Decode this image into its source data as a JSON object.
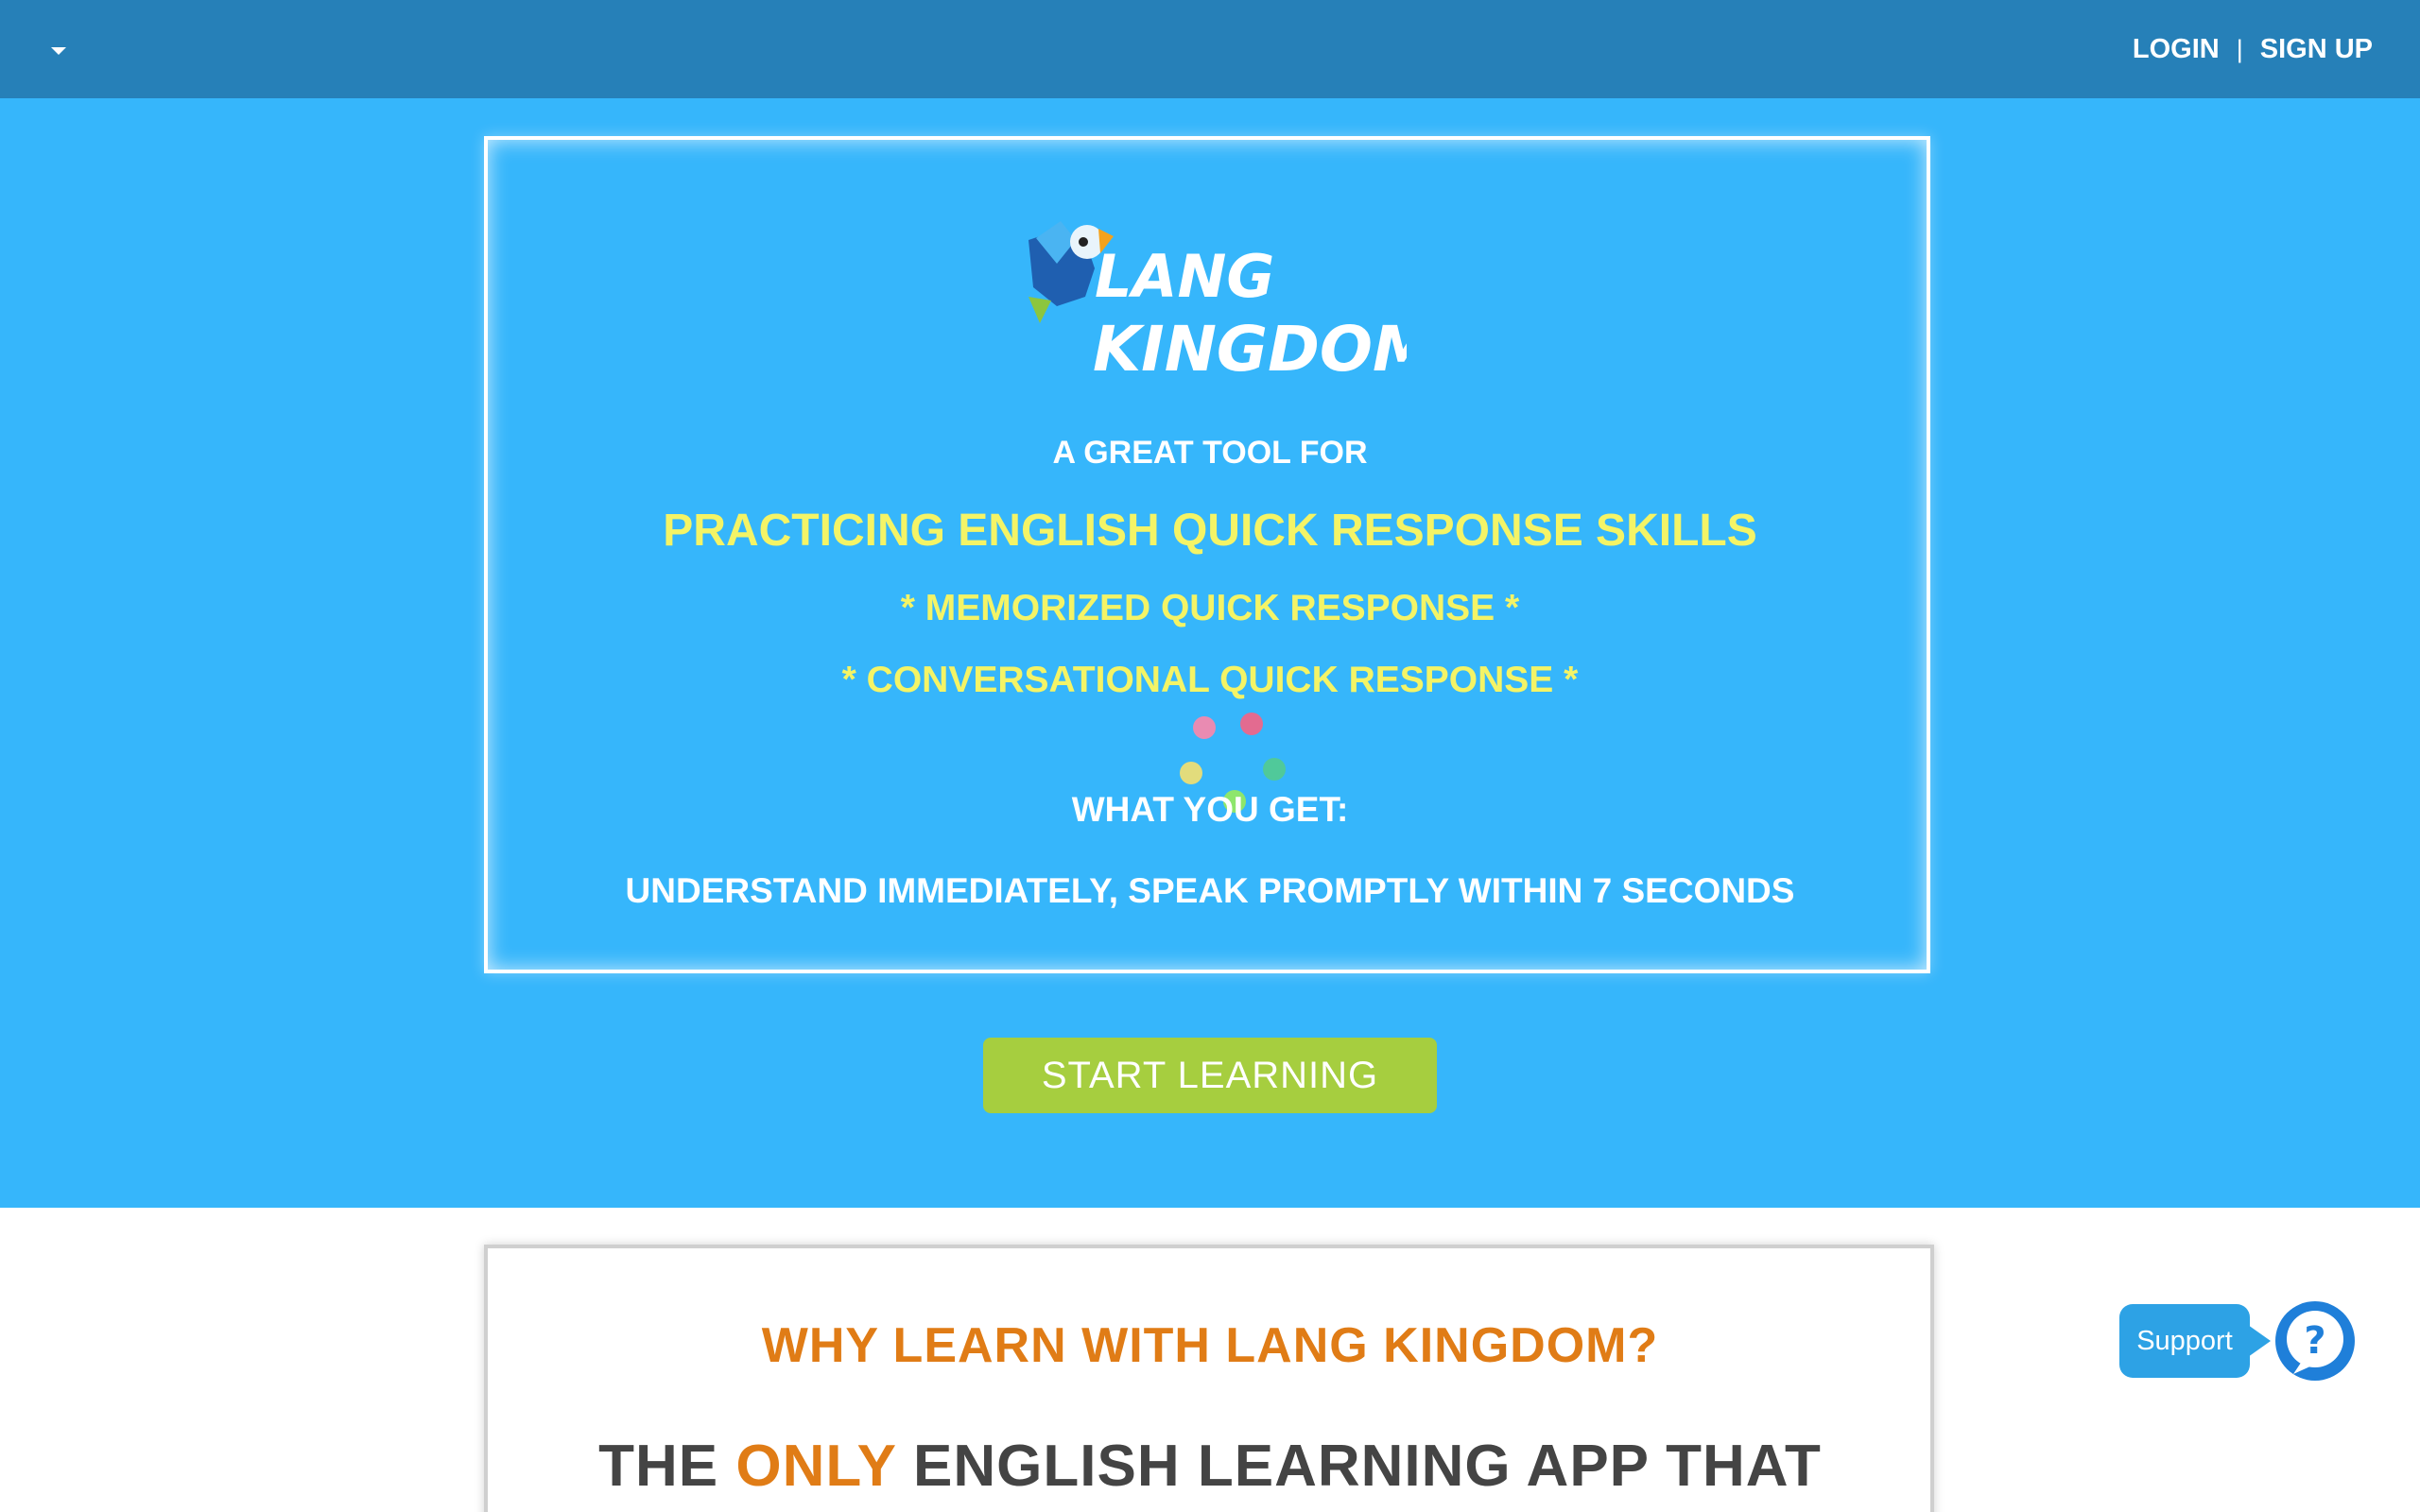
{
  "nav": {
    "login_label": "LOGIN",
    "separator": "|",
    "signup_label": "SIGN UP"
  },
  "hero": {
    "logo_alt": "LANG KINGDOM",
    "logo_line1": "LANG",
    "logo_line2": "KINGDOM",
    "tagline_intro": "A GREAT TOOL FOR",
    "tagline_main": "PRACTICING ENGLISH QUICK RESPONSE SKILLS",
    "feature_1": "* MEMORIZED QUICK RESPONSE *",
    "feature_2": "* CONVERSATIONAL QUICK RESPONSE *",
    "benefit_heading": "WHAT YOU GET:",
    "benefit_text": "UNDERSTAND IMMEDIATELY, SPEAK PROMPTLY WITHIN 7 SECONDS",
    "cta_label": "START LEARNING"
  },
  "why": {
    "title": "WHY LEARN WITH LANG KINGDOM?",
    "headline_pre": "THE",
    "headline_accent": "ONLY",
    "headline_post": "ENGLISH LEARNING APP THAT"
  },
  "support": {
    "label": "Support",
    "icon": "question-icon"
  },
  "icons": {
    "menu": "caret-down-icon",
    "logo": "parrot-logo-icon",
    "loader": "loading-spinner-icon",
    "help": "question-chat-icon"
  },
  "colors": {
    "topbar": "#2680b8",
    "hero_bg": "#36b6fb",
    "accent_yellow": "#f4f466",
    "cta_green": "#a6ce3f",
    "accent_orange": "#e07c16",
    "support_blue": "#2da2e5",
    "help_blue": "#1f7fd9"
  }
}
